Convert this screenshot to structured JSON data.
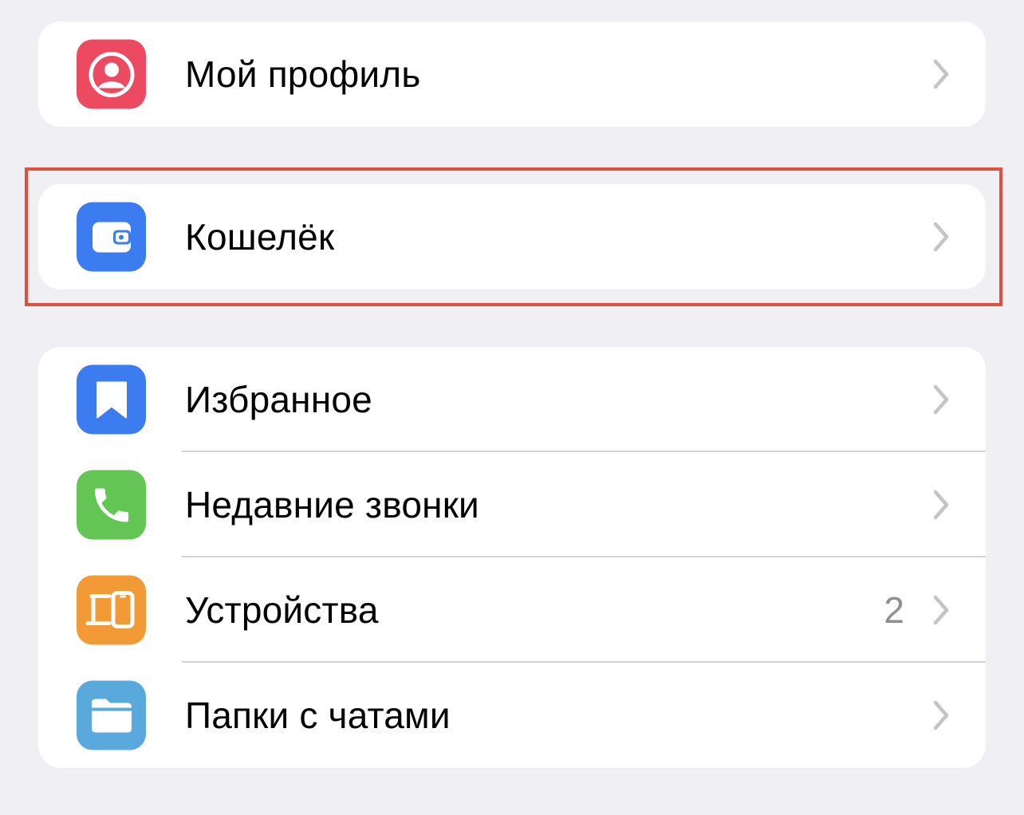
{
  "colors": {
    "background": "#efeff4",
    "card": "#ffffff",
    "highlight": "#e0503e",
    "chevron": "#c4c4c7",
    "value": "#8e8e93"
  },
  "groups": [
    {
      "items": [
        {
          "label": "Мой профиль",
          "icon": "profile-icon",
          "icon_color": "#eb4a61"
        }
      ]
    },
    {
      "items": [
        {
          "label": "Кошелёк",
          "icon": "wallet-icon",
          "icon_color": "#3b7cf1"
        }
      ]
    },
    {
      "items": [
        {
          "label": "Избранное",
          "icon": "bookmark-icon",
          "icon_color": "#3b7cf1"
        },
        {
          "label": "Недавние звонки",
          "icon": "phone-icon",
          "icon_color": "#62c554"
        },
        {
          "label": "Устройства",
          "icon": "devices-icon",
          "icon_color": "#f29a36",
          "value": "2"
        },
        {
          "label": "Папки с чатами",
          "icon": "folder-icon",
          "icon_color": "#5aa9dc"
        }
      ]
    }
  ],
  "highlighted_item": "Кошелёк"
}
